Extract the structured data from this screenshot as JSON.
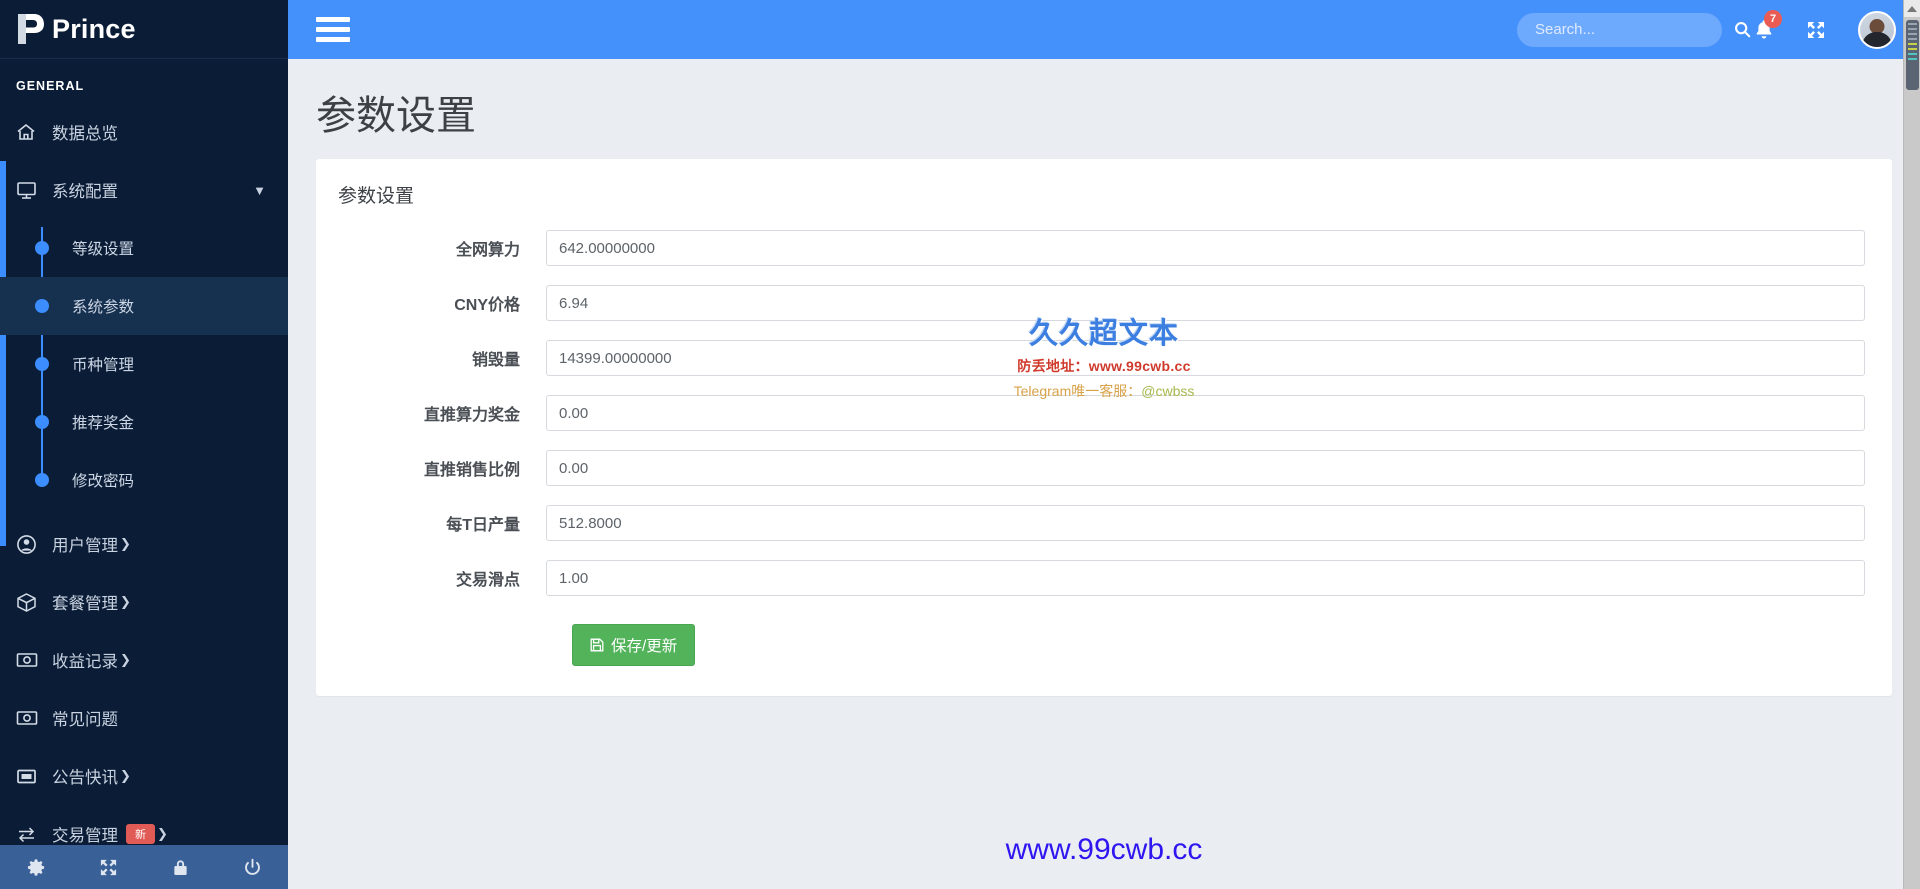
{
  "brand": {
    "name": "Prince",
    "logo_icon": "prince-logo-icon"
  },
  "sidebar": {
    "section_label": "GENERAL",
    "items": [
      {
        "label": "数据总览",
        "icon": "home-icon",
        "has_caret": false,
        "type": "link"
      },
      {
        "label": "系统配置",
        "icon": "monitor-icon",
        "has_caret": false,
        "type": "group",
        "expanded": true,
        "children": [
          {
            "label": "等级设置",
            "active": false
          },
          {
            "label": "系统参数",
            "active": true
          },
          {
            "label": "币种管理",
            "active": false
          },
          {
            "label": "推荐奖金",
            "active": false
          },
          {
            "label": "修改密码",
            "active": false
          }
        ]
      },
      {
        "label": "用户管理",
        "icon": "user-circle-icon",
        "has_caret": true,
        "type": "group"
      },
      {
        "label": "套餐管理",
        "icon": "box-icon",
        "has_caret": true,
        "type": "group"
      },
      {
        "label": "收益记录",
        "icon": "money-icon",
        "has_caret": true,
        "type": "group"
      },
      {
        "label": "常见问题",
        "icon": "money-icon",
        "has_caret": false,
        "type": "link"
      },
      {
        "label": "公告快讯",
        "icon": "window-icon",
        "has_caret": true,
        "type": "group"
      },
      {
        "label": "交易管理",
        "icon": "exchange-icon",
        "has_caret": true,
        "type": "group",
        "badge": "新"
      }
    ],
    "footer_icons": [
      {
        "name": "gear-icon"
      },
      {
        "name": "expand-arrows-icon"
      },
      {
        "name": "lock-icon"
      },
      {
        "name": "power-icon"
      }
    ]
  },
  "topbar": {
    "menu_toggle_icon": "hamburger-icon",
    "search": {
      "value": "",
      "placeholder": "Search...",
      "icon": "search-icon"
    },
    "notifications": {
      "icon": "bell-icon",
      "count": "7"
    },
    "fullscreen": {
      "icon": "expand-arrows-icon"
    },
    "avatar": {
      "icon": "avatar",
      "alt": "user-avatar"
    }
  },
  "page": {
    "title": "参数设置",
    "card_title": "参数设置",
    "fields": [
      {
        "label": "全网算力",
        "value": "642.00000000"
      },
      {
        "label": "CNY价格",
        "value": "6.94"
      },
      {
        "label": "销毁量",
        "value": "14399.00000000"
      },
      {
        "label": "直推算力奖金",
        "value": "0.00"
      },
      {
        "label": "直推销售比例",
        "value": "0.00"
      },
      {
        "label": "每T日产量",
        "value": "512.8000"
      },
      {
        "label": "交易滑点",
        "value": "1.00"
      }
    ],
    "save_button": {
      "label": "保存/更新",
      "icon": "save-icon",
      "color": "#52b35a"
    }
  },
  "watermark": {
    "line1": "久久超文本",
    "line2": "防丢地址：www.99cwb.cc",
    "line3_prefix": "Telegram唯一客服：",
    "line3_handle": "@cwbss"
  },
  "footer": {
    "url": "www.99cwb.cc",
    "color": "#2f16f0"
  },
  "colors": {
    "sidebar_bg": "#0b1c36",
    "topbar_blue": "#4591fc",
    "accent_blue": "#3c8dff",
    "active_submenu": "#16304f",
    "save_green": "#52b35a",
    "badge_red": "#ea5b54"
  },
  "scrollbar": {
    "up_arrow_icon": "triangle-up-icon",
    "thumb": "scroll-thumb"
  }
}
